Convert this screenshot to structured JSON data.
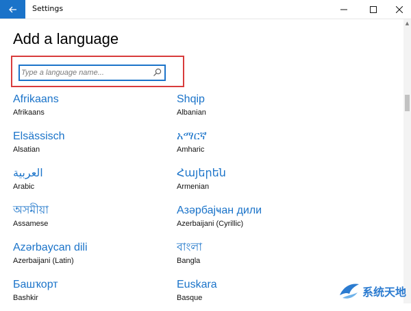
{
  "window": {
    "app_title": "Settings",
    "accent_color": "#1a73c9"
  },
  "page": {
    "title": "Add a language"
  },
  "search": {
    "placeholder": "Type a language name...",
    "highlight_color": "#d83b3b"
  },
  "languages": [
    {
      "native": "Afrikaans",
      "english": "Afrikaans"
    },
    {
      "native": "Shqip",
      "english": "Albanian"
    },
    {
      "native": "Elsässisch",
      "english": "Alsatian"
    },
    {
      "native": "አማርኛ",
      "english": "Amharic"
    },
    {
      "native": "العربية",
      "english": "Arabic"
    },
    {
      "native": "Հայերեն",
      "english": "Armenian"
    },
    {
      "native": "অসমীয়া",
      "english": "Assamese"
    },
    {
      "native": "Азәрбајҹан дили",
      "english": "Azerbaijani (Cyrillic)"
    },
    {
      "native": "Azərbaycan dili",
      "english": "Azerbaijani (Latin)"
    },
    {
      "native": "বাংলা",
      "english": "Bangla"
    },
    {
      "native": "Башҡорт",
      "english": "Bashkir"
    },
    {
      "native": "Euskara",
      "english": "Basque"
    }
  ],
  "watermark": {
    "text": "系统天地"
  }
}
